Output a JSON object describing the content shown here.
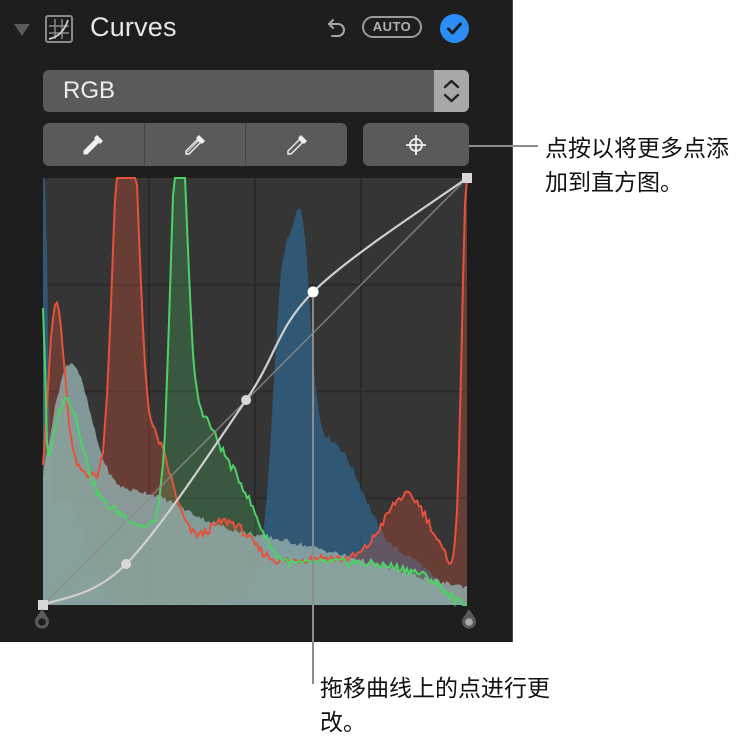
{
  "header": {
    "title": "Curves",
    "auto_label": "AUTO",
    "icons": {
      "disclosure": "disclosure-triangle-icon",
      "section": "curves-adjustment-icon",
      "undo": "undo-arrow-icon",
      "confirm": "checkmark-circle-icon"
    },
    "accent_color": "#2a8ef5"
  },
  "channel_select": {
    "value": "RGB",
    "icon": "up-down-chevron-icon"
  },
  "eyedroppers": [
    {
      "name": "black-point-eyedropper",
      "icon": "eyedropper-filled-icon"
    },
    {
      "name": "gray-point-eyedropper",
      "icon": "eyedropper-half-icon"
    },
    {
      "name": "white-point-eyedropper",
      "icon": "eyedropper-outline-icon"
    }
  ],
  "add_point_button": {
    "icon": "crosshair-icon"
  },
  "histogram": {
    "channel_colors": {
      "red": "#e8513a",
      "green": "#4cd265",
      "blue": "#2f5e80",
      "luminance": "#8fa9a9"
    },
    "curve_points": [
      {
        "input": 0,
        "output": 0
      },
      {
        "input": 0.196,
        "output": 0.096
      },
      {
        "input": 0.479,
        "output": 0.48
      },
      {
        "input": 0.637,
        "output": 0.733
      },
      {
        "input": 1.0,
        "output": 1.0
      }
    ],
    "grid_divisions": 4
  },
  "handles": {
    "black_point": "black-point-handle",
    "white_point": "white-point-handle"
  },
  "callouts": {
    "add_point": "点按以将更多点添加到直方图。",
    "drag_point": "拖移曲线上的点进行更改。"
  }
}
